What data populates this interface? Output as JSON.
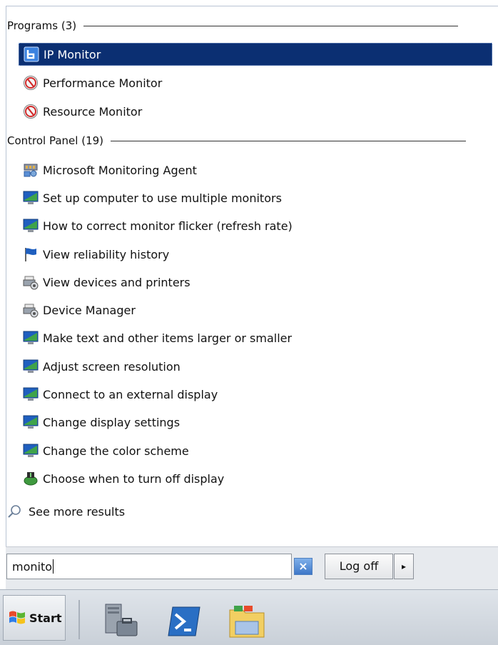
{
  "groups": [
    {
      "header": "Programs (3)",
      "items": [
        {
          "label": "IP Monitor",
          "icon": "ip-monitor-icon",
          "selected": true
        },
        {
          "label": "Performance Monitor",
          "icon": "performance-monitor-icon"
        },
        {
          "label": "Resource Monitor",
          "icon": "resource-monitor-icon"
        }
      ]
    },
    {
      "header": "Control Panel (19)",
      "items": [
        {
          "label": "Microsoft Monitoring Agent",
          "icon": "monitoring-agent-icon"
        },
        {
          "label": "Set up computer to use multiple monitors",
          "icon": "display-icon"
        },
        {
          "label": "How to correct monitor flicker (refresh rate)",
          "icon": "display-icon"
        },
        {
          "label": "View reliability history",
          "icon": "flag-icon"
        },
        {
          "label": "View devices and printers",
          "icon": "devices-printers-icon"
        },
        {
          "label": "Device Manager",
          "icon": "device-manager-icon"
        },
        {
          "label": "Make text and other items larger or smaller",
          "icon": "display-icon"
        },
        {
          "label": "Adjust screen resolution",
          "icon": "display-icon"
        },
        {
          "label": "Connect to an external display",
          "icon": "display-icon"
        },
        {
          "label": "Change display settings",
          "icon": "display-icon"
        },
        {
          "label": "Change the color scheme",
          "icon": "display-icon"
        },
        {
          "label": "Choose when to turn off display",
          "icon": "power-options-icon"
        }
      ]
    }
  ],
  "see_more": "See more results",
  "search": {
    "value": "monito"
  },
  "buttons": {
    "clear_icon": "clear-icon",
    "logoff": "Log off",
    "arrow": "▸"
  },
  "taskbar": {
    "start_label": "Start",
    "icons": [
      "server-manager-icon",
      "powershell-icon",
      "file-explorer-icon"
    ]
  },
  "colors": {
    "selection": "#0b2f72",
    "accent": "#3d77c8"
  }
}
